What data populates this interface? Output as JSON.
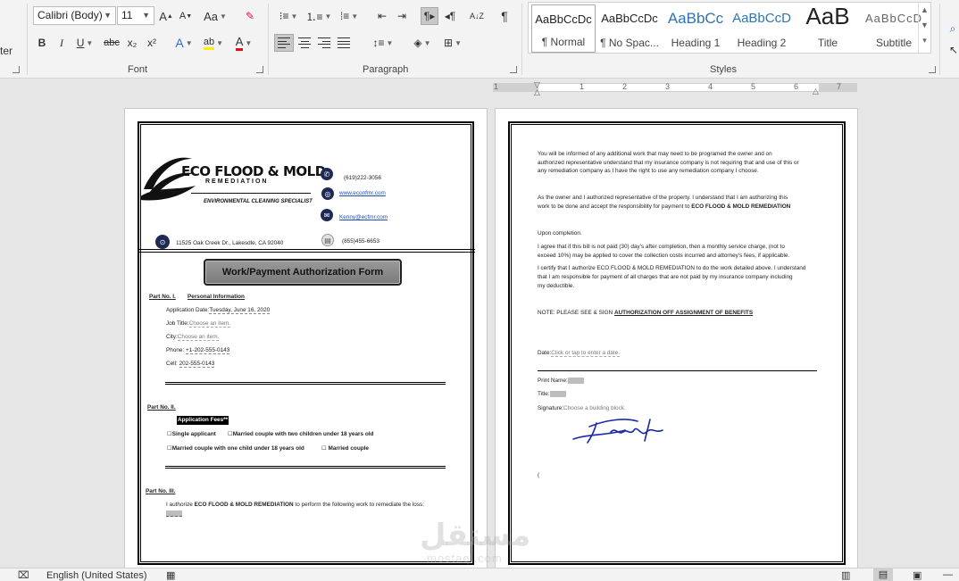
{
  "ribbon": {
    "left_cut_label": "ter",
    "font": {
      "name": "Calibri (Body)",
      "size": "11",
      "group_label": "Font",
      "buttons": {
        "grow": "A",
        "shrink": "A",
        "change_case": "Aa",
        "bold": "B",
        "italic": "I",
        "underline": "U",
        "strike": "abc",
        "subscript": "x₂",
        "superscript": "x²",
        "text_effects": "A",
        "highlight": "ab",
        "font_color": "A"
      }
    },
    "paragraph": {
      "group_label": "Paragraph",
      "sort": "A↓Z",
      "pilcrow": "¶"
    },
    "styles": {
      "group_label": "Styles",
      "items": [
        {
          "sample": "AaBbCcDc",
          "name": "¶ Normal"
        },
        {
          "sample": "AaBbCcDc",
          "name": "¶ No Spac..."
        },
        {
          "sample": "AaBbCc",
          "name": "Heading 1"
        },
        {
          "sample": "AaBbCcD",
          "name": "Heading 2"
        },
        {
          "sample": "AaB",
          "name": "Title"
        },
        {
          "sample": "AaBbCcD",
          "name": "Subtitle"
        }
      ]
    }
  },
  "ruler": {
    "numbers": [
      "1",
      "1",
      "2",
      "3",
      "4",
      "5",
      "6",
      "7"
    ]
  },
  "page1": {
    "logo": {
      "main": "ECO FLOOD & MOLD",
      "sub": "REMEDIATION",
      "tagline": "ENVIRONMENTAL CLEANING SPECIALIST"
    },
    "contact": {
      "phone": "(619)222-3056",
      "website": "www.econfmr.com",
      "email": "Kenny@ecfmr.com",
      "fax": "(855)455-6653",
      "address": "11525 Oak Creek Dr., Lakesdle, CA 92040"
    },
    "form_title": "Work/Payment Authorization Form",
    "part1": {
      "label": "Part No. I.",
      "heading": "Personal Information",
      "app_date_label": "Application Date:",
      "app_date_value": "Tuesday, June 16, 2020",
      "job_title_label": "Job Title:",
      "job_title_value": "Choose an item.",
      "city_label": "City:",
      "city_value": "Choose an item.",
      "phone_label": "Phone: ",
      "phone_value": "+1-202-555-0143",
      "cell_label": "Cell: ",
      "cell_value": "202-555-0143"
    },
    "part2": {
      "label": "Part No. II.",
      "heading": "Application Fees**",
      "opt1": "☐Single applicant",
      "opt2": "☐Married couple with two children under 18 years old",
      "opt3": "☐Married couple with one child under 18 years old",
      "opt4": "☐ Married couple"
    },
    "part3": {
      "label": "Part No. III.",
      "text_pre": "I authorize ",
      "text_bold": "ECO FLOOD & MOLD REMEDIATION",
      "text_post": " to perform the following work to remediate the loss:"
    }
  },
  "page2": {
    "para1_l1": "You will be informed of any additional work that may need to be programed the owner and on",
    "para1_l2": "authorized representative understand that my insurance company is not requiring that and use of this or",
    "para1_l3": "any remediation company as I have the right to use any remediation company I choose.",
    "para2_l1": "As the owner and I authorized representative of the property. I understand that I am authorizing this",
    "para2_l2_pre": "work to be done and accept the responsibility for payment to ",
    "para2_l2_bold": "ECO FLOOD & MOLD REMEDIATION",
    "para3": "Upon completion.",
    "para4_l1": "I agree that if this bill is not paid (30) day's after completion, then a monthly service charge, (not to",
    "para4_l2": "exceed 10%) may be applied to cover the collection costs incurred and attorney's fees, if applicable.",
    "para5_l1": "I certify that I authorize ECO FLOOD & MOLD REMEDIATION to do the work detailed above. I understand",
    "para5_l2": "that I am responsible for payment of all charges that are not paid by my insurance company including",
    "para5_l3": "my deductible.",
    "note_pre": "NOTE: PLEASE SEE & SIGN ",
    "note_bold": "AUTHORIZATION OFF ASSIGNMENT OF BENEFITS",
    "date_label": "Date:",
    "date_value": "Click or tap to enter a date.",
    "print_name_label": "Print Name:",
    "title_label": "Title:",
    "signature_label": "Signature:",
    "signature_value": "Choose a building block.",
    "trailing": "("
  },
  "watermark": {
    "main": "مستقل",
    "sub": "mostaql.com"
  },
  "status": {
    "language": "English (United States)"
  }
}
